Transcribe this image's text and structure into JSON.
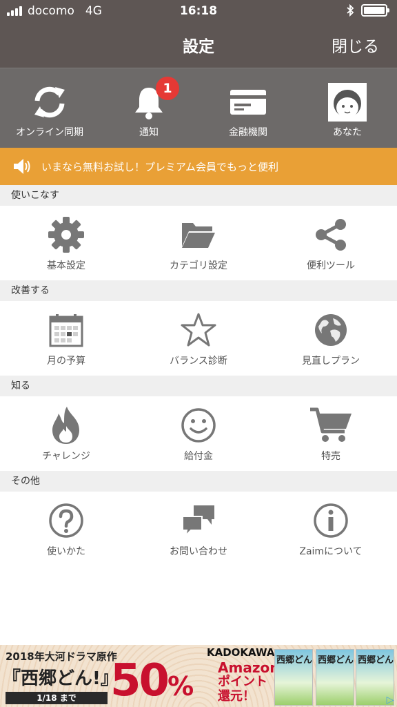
{
  "status": {
    "carrier": "docomo",
    "network": "4G",
    "time": "16:18"
  },
  "nav": {
    "title": "設定",
    "close_label": "閉じる"
  },
  "top_row": [
    {
      "label": "オンライン同期",
      "icon": "sync-icon"
    },
    {
      "label": "通知",
      "icon": "bell-icon",
      "badge": "1"
    },
    {
      "label": "金融機関",
      "icon": "card-icon"
    },
    {
      "label": "あなた",
      "icon": "avatar-icon"
    }
  ],
  "promo": {
    "text": "いまなら無料お試し！プレミアム会員でもっと便利",
    "icon": "speaker-icon"
  },
  "sections": [
    {
      "header": "使いこなす",
      "items": [
        {
          "label": "基本設定",
          "icon": "gear-icon"
        },
        {
          "label": "カテゴリ設定",
          "icon": "folder-icon"
        },
        {
          "label": "便利ツール",
          "icon": "share-icon"
        }
      ]
    },
    {
      "header": "改善する",
      "items": [
        {
          "label": "月の予算",
          "icon": "calendar-icon"
        },
        {
          "label": "バランス診断",
          "icon": "star-icon"
        },
        {
          "label": "見直しプラン",
          "icon": "globe-icon"
        }
      ]
    },
    {
      "header": "知る",
      "items": [
        {
          "label": "チャレンジ",
          "icon": "flame-icon"
        },
        {
          "label": "給付金",
          "icon": "smiley-icon"
        },
        {
          "label": "特売",
          "icon": "cart-icon"
        }
      ]
    },
    {
      "header": "その他",
      "items": [
        {
          "label": "使いかた",
          "icon": "question-icon"
        },
        {
          "label": "お問い合わせ",
          "icon": "chat-icon"
        },
        {
          "label": "Zaimについて",
          "icon": "info-icon"
        }
      ]
    }
  ],
  "ad": {
    "line1": "2018年大河ドラマ原作",
    "line2": "『西郷どん!』",
    "deadline": "1/18 まで",
    "percent": "50",
    "percent_sign": "%",
    "brand": "KADOKAWA",
    "amazon": "Amazon",
    "point": "ポイント",
    "kangen": "還元！",
    "books": [
      "西郷どん",
      "西郷どん",
      "西郷どん"
    ]
  },
  "colors": {
    "nav_bg": "#5e5654",
    "toprow_bg": "#6d6a69",
    "promo_bg": "#e9a036",
    "badge": "#e53935",
    "icon_gray": "#777777"
  }
}
